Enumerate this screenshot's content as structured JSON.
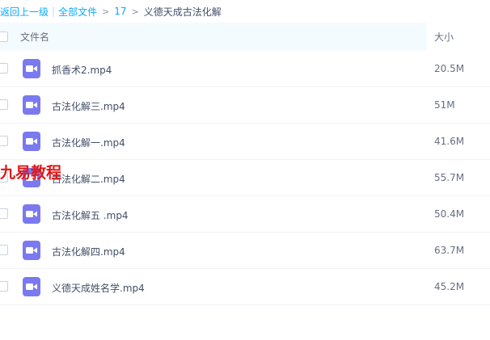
{
  "breadcrumb": {
    "back": "返回上一级",
    "all_files": "全部文件",
    "folder_17": "17",
    "current": "义德天成古法化解",
    "arrow": ">"
  },
  "table": {
    "col_name": "文件名",
    "col_size": "大小"
  },
  "files": [
    {
      "name": "抓香术2.mp4",
      "size": "20.5M"
    },
    {
      "name": "古法化解三.mp4",
      "size": "51M"
    },
    {
      "name": "古法化解一.mp4",
      "size": "41.6M"
    },
    {
      "name": "古法化解二.mp4",
      "size": "55.7M"
    },
    {
      "name": "古法化解五 .mp4",
      "size": "50.4M"
    },
    {
      "name": "古法化解四.mp4",
      "size": "63.7M"
    },
    {
      "name": "义德天成姓名学.mp4",
      "size": "45.2M"
    }
  ],
  "watermark": "九易教程",
  "colors": {
    "link": "#09aaff",
    "video_icon": "#7b79f0",
    "watermark": "#e01818"
  }
}
